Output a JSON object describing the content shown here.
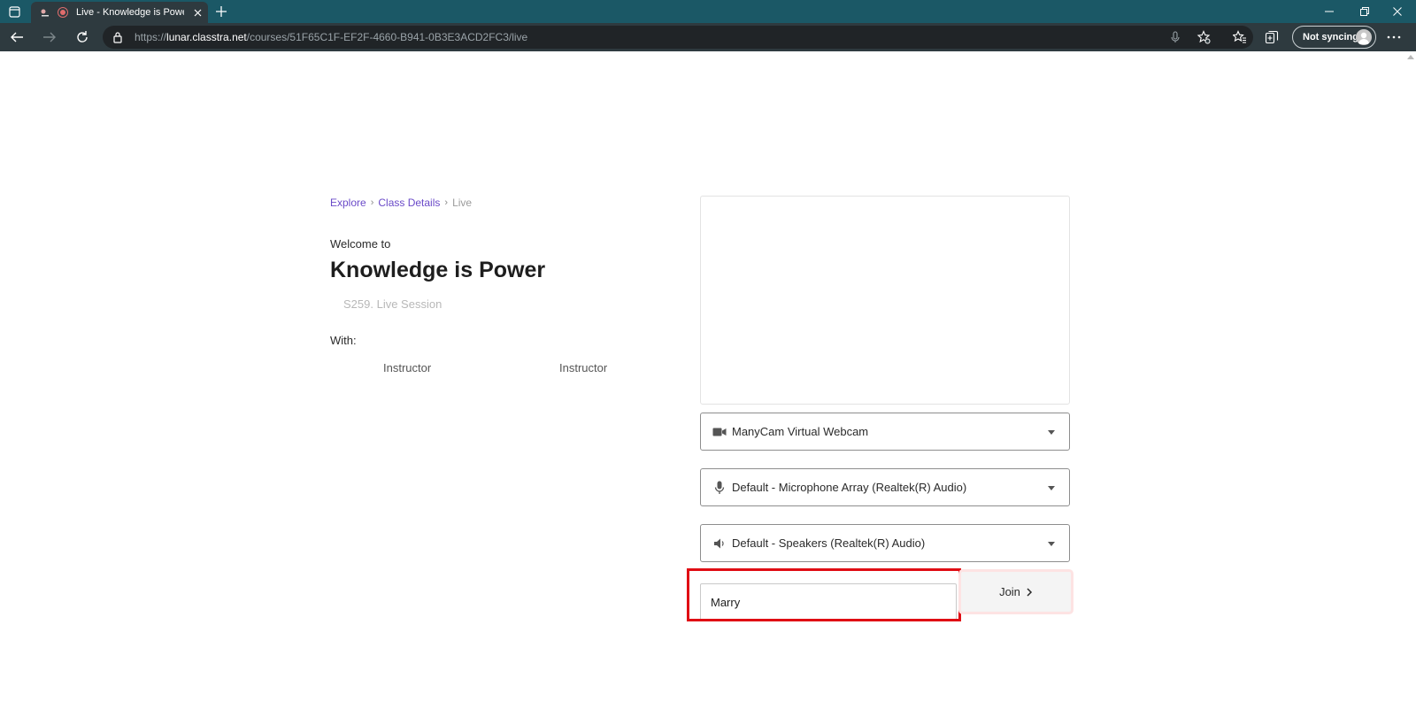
{
  "browser": {
    "tab_title": "Live - Knowledge is Power |",
    "url_scheme": "https://",
    "url_host": "lunar.classtra.net",
    "url_path": "/courses/51F65C1F-EF2F-4660-B941-0B3E3ACD2FC3/live",
    "profile_label": "Not syncing"
  },
  "breadcrumb": {
    "items": [
      "Explore",
      "Class Details"
    ],
    "separator": "›",
    "current": "Live"
  },
  "session": {
    "welcome": "Welcome to",
    "title": "Knowledge is Power",
    "subtitle": "S259. Live Session",
    "with_label": "With:",
    "instructors": [
      "Instructor",
      "Instructor"
    ]
  },
  "devices": {
    "camera": "ManyCam Virtual Webcam",
    "microphone": "Default - Microphone Array (Realtek(R) Audio)",
    "speakers": "Default - Speakers (Realtek(R) Audio)"
  },
  "join": {
    "name_value": "Marry",
    "button_label": "Join"
  },
  "colors": {
    "tabbar": "#1b5866",
    "link": "#6a4ac8",
    "highlight": "#e00d14"
  }
}
